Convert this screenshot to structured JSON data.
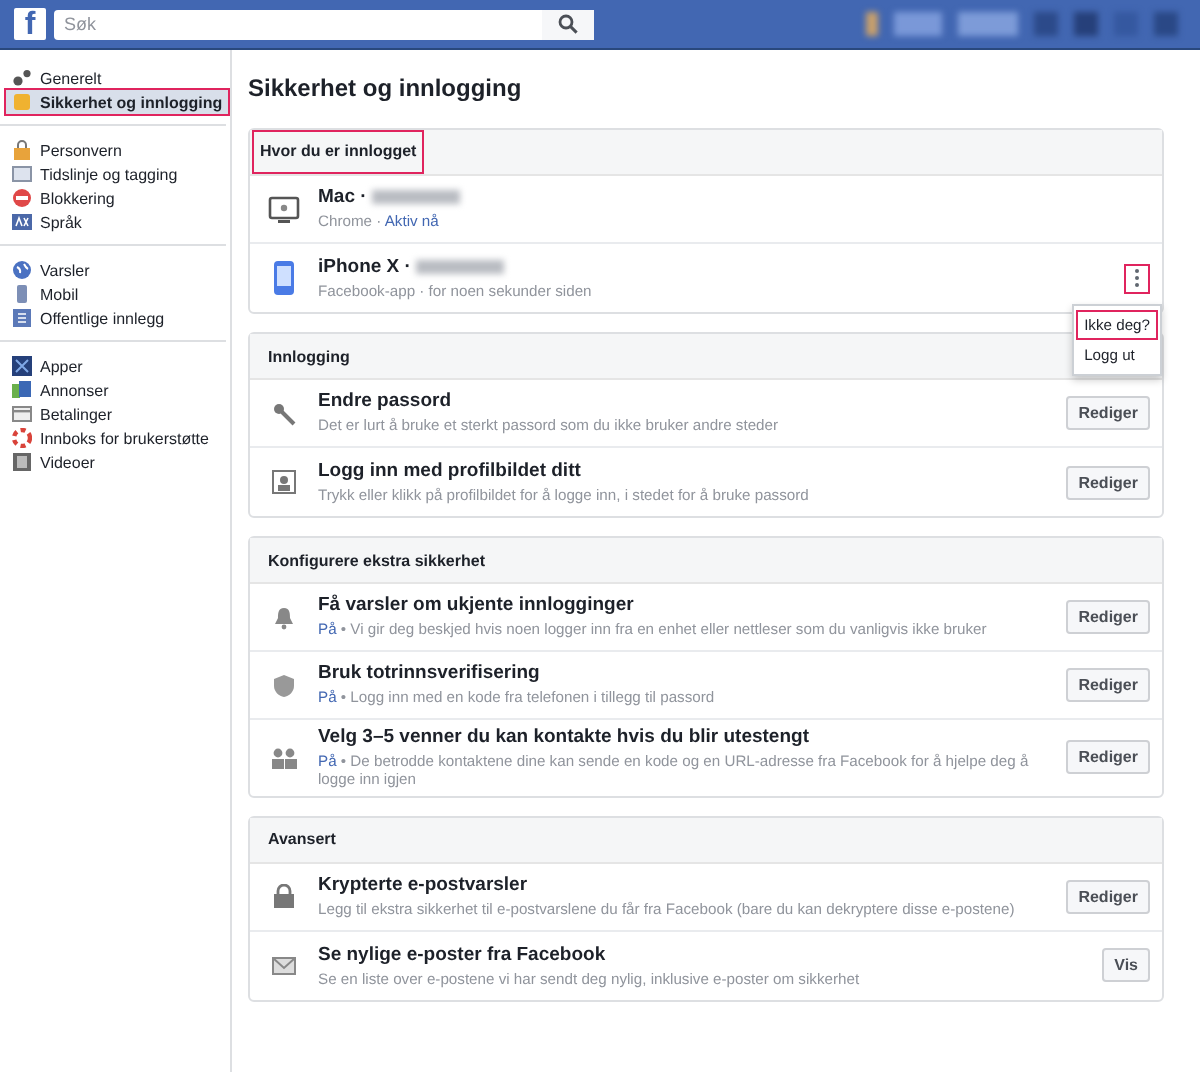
{
  "top_bar": {
    "logo": "f",
    "search": {
      "placeholder": "Søk"
    }
  },
  "sidebar": {
    "groups": [
      [
        {
          "label": "Generelt",
          "selected": false,
          "highlighted": false
        },
        {
          "label": "Sikkerhet og innlogging",
          "selected": true,
          "highlighted": true
        }
      ],
      [
        {
          "label": "Personvern",
          "selected": false,
          "highlighted": false
        },
        {
          "label": "Tidslinje og tagging",
          "selected": false,
          "highlighted": false
        },
        {
          "label": "Blokkering",
          "selected": false,
          "highlighted": false
        },
        {
          "label": "Språk",
          "selected": false,
          "highlighted": false
        }
      ],
      [
        {
          "label": "Varsler",
          "selected": false,
          "highlighted": false
        },
        {
          "label": "Mobil",
          "selected": false,
          "highlighted": false
        },
        {
          "label": "Offentlige innlegg",
          "selected": false,
          "highlighted": false
        }
      ],
      [
        {
          "label": "Apper",
          "selected": false,
          "highlighted": false
        },
        {
          "label": "Annonser",
          "selected": false,
          "highlighted": false
        },
        {
          "label": "Betalinger",
          "selected": false,
          "highlighted": false
        },
        {
          "label": "Innboks for brukerstøtte",
          "selected": false,
          "highlighted": false
        },
        {
          "label": "Videoer",
          "selected": false,
          "highlighted": false
        }
      ]
    ]
  },
  "page_title": "Sikkerhet og innlogging",
  "sections": [
    {
      "title": "Hvor du er innlogget",
      "highlighted": true,
      "rows": [
        {
          "kind": "session",
          "title": "Mac ·",
          "detail": "Chrome ·",
          "active": "Aktiv nå"
        },
        {
          "kind": "session",
          "title": "iPhone X ·",
          "detail": "Facebook-app · for noen sekunder siden",
          "menu": {
            "highlighted": true,
            "items": [
              {
                "label": "Ikke deg?",
                "highlighted": true
              },
              {
                "label": "Logg ut",
                "highlighted": false
              }
            ]
          }
        }
      ]
    },
    {
      "title": "Innlogging",
      "highlighted": false,
      "rows": [
        {
          "kind": "setting",
          "title": "Endre passord",
          "detail": "Det er lurt å bruke et sterkt passord som du ikke bruker andre steder",
          "button": "Rediger"
        },
        {
          "kind": "setting",
          "title": "Logg inn med profilbildet ditt",
          "detail": "Trykk eller klikk på profilbildet for å logge inn, i stedet for å bruke passord",
          "button": "Rediger"
        }
      ]
    },
    {
      "title": "Konfigurere ekstra sikkerhet",
      "highlighted": false,
      "rows": [
        {
          "kind": "setting",
          "title": "Få varsler om ukjente innlogginger",
          "status": "På",
          "detail": "• Vi gir deg beskjed hvis noen logger inn fra en enhet eller nettleser som du vanligvis ikke bruker",
          "button": "Rediger"
        },
        {
          "kind": "setting",
          "title": "Bruk totrinnsverifisering",
          "status": "På",
          "detail": "• Logg inn med en kode fra telefonen i tillegg til passord",
          "button": "Rediger"
        },
        {
          "kind": "setting",
          "title": "Velg 3–5 venner du kan kontakte hvis du blir utestengt",
          "status": "På",
          "detail": "• De betrodde kontaktene dine kan sende en kode og en URL-adresse fra Facebook for å hjelpe deg å logge inn igjen",
          "button": "Rediger"
        }
      ]
    },
    {
      "title": "Avansert",
      "highlighted": false,
      "rows": [
        {
          "kind": "setting",
          "title": "Krypterte e-postvarsler",
          "detail": "Legg til ekstra sikkerhet til e-postvarslene du får fra Facebook (bare du kan dekryptere disse e-postene)",
          "button": "Rediger"
        },
        {
          "kind": "setting",
          "title": "Se nylige e-poster fra Facebook",
          "detail": "Se en liste over e-postene vi har sendt deg nylig, inklusive e-poster om sikkerhet",
          "button": "Vis"
        }
      ]
    }
  ]
}
